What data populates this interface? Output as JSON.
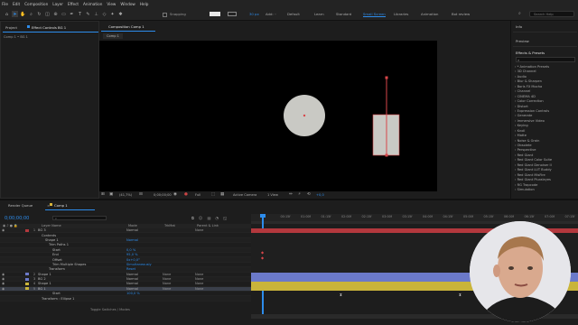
{
  "menu": [
    "File",
    "Edit",
    "Composition",
    "Layer",
    "Effect",
    "Animation",
    "View",
    "Window",
    "Help"
  ],
  "toolbar": {
    "snapping": "Snapping",
    "stroke_size": "30 px",
    "workspaces": [
      "Default",
      "Learn",
      "Standard",
      "Small Screen",
      "Libraries",
      "Animation",
      "Bot review"
    ],
    "active_workspace": "Small Screen",
    "search_placeholder": "Search Help"
  },
  "left_panel": {
    "tab_project": "Project",
    "tab_effect_controls": "Effect Controls BG 1",
    "breadcrumb": "Comp 1 • BG 1"
  },
  "comp_panel": {
    "tab": "Composition Comp 1",
    "comp_tab": "Comp 1"
  },
  "view_footer": {
    "zoom": "(41,7%)",
    "timecode": "0;00;00;00",
    "resolution": "Full",
    "camera": "Active Camera",
    "views": "1 View",
    "exposure": "+0,0"
  },
  "right_panel": {
    "info": "Info",
    "preview": "Preview",
    "effects_title": "Effects & Presets",
    "effects": [
      "* Animation Presets",
      "3D Channel",
      "Audio",
      "Blur & Sharpen",
      "Boris FX Mocha",
      "Channel",
      "CINEMA 4D",
      "Color Correction",
      "Distort",
      "Expression Controls",
      "Generate",
      "Immersive Video",
      "Keying",
      "Knoll",
      "Matte",
      "Noise & Grain",
      "Obsolete",
      "Perspective",
      "Red Giant",
      "Red Giant Color Suite",
      "Red Giant Denoiser II",
      "Red Giant LUT Buddy",
      "Red Giant MisFire",
      "Red Giant Pluraleyes",
      "RG Trapcode",
      "Simulation"
    ]
  },
  "timeline": {
    "tab_render": "Render Queue",
    "tab_comp": "Comp 1",
    "timecode": "0;00;00;00",
    "columns": {
      "layer_name": "Layer Name",
      "mode": "Mode",
      "trkmat": "TrkMat",
      "parent": "Parent & Link"
    },
    "ruler": [
      "0f",
      "00:15f",
      "01:00f",
      "01:15f",
      "02:00f",
      "02:15f",
      "03:00f",
      "03:15f",
      "04:00f",
      "04:15f",
      "05:00f",
      "05:15f",
      "06:00f",
      "06:15f",
      "07:00f",
      "07:15f"
    ],
    "rows": [
      {
        "num": "1",
        "name": "BG 3",
        "mode": "Normal",
        "trk": "",
        "parent": "None"
      },
      {
        "num": "",
        "name": "Contents",
        "mode": "",
        "trk": "",
        "parent": ""
      },
      {
        "num": "",
        "name": "Shape 1",
        "mode": "Normal",
        "trk": "",
        "parent": ""
      },
      {
        "num": "",
        "name": "Trim Paths 1",
        "mode": "",
        "trk": "",
        "parent": ""
      },
      {
        "num": "",
        "name": "Start",
        "mode": "0,0 %",
        "trk": "",
        "parent": ""
      },
      {
        "num": "",
        "name": "End",
        "mode": "95,0 %",
        "trk": "",
        "parent": ""
      },
      {
        "num": "",
        "name": "Offset",
        "mode": "0x+0,0°",
        "trk": "",
        "parent": ""
      },
      {
        "num": "",
        "name": "Trim Multiple Shapes",
        "mode": "Simultaneously",
        "trk": "",
        "parent": ""
      },
      {
        "num": "",
        "name": "Transform",
        "mode": "Reset",
        "trk": "",
        "parent": ""
      },
      {
        "num": "2",
        "name": "Shape 1",
        "mode": "Normal",
        "trk": "None",
        "parent": "None"
      },
      {
        "num": "3",
        "name": "BG 2",
        "mode": "Normal",
        "trk": "None",
        "parent": "None"
      },
      {
        "num": "4",
        "name": "Shape 1",
        "mode": "Normal",
        "trk": "None",
        "parent": "None"
      },
      {
        "num": "5",
        "name": "BG 1",
        "mode": "Normal",
        "trk": "None",
        "parent": "None"
      },
      {
        "num": "",
        "name": "Start",
        "mode": "100,0 %",
        "trk": "",
        "parent": ""
      },
      {
        "num": "",
        "name": "Transform : Ellipse 1",
        "mode": "",
        "trk": "",
        "parent": ""
      }
    ],
    "footer": "Toggle Switches / Modes",
    "colors": {
      "accent": "#2d8ceb",
      "red_layer": "#b3383d",
      "blue_layer": "#6b79c9",
      "yellow_layer": "#c9b43a",
      "playhead": "#2d8ceb"
    }
  }
}
